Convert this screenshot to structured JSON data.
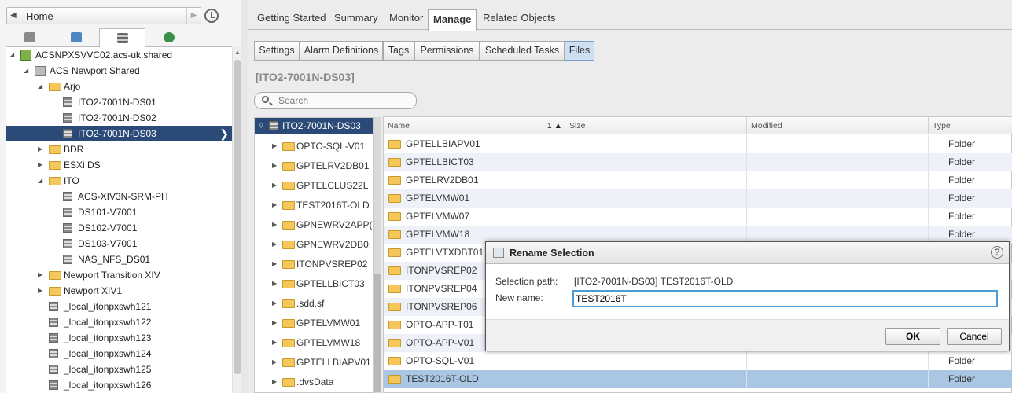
{
  "nav": {
    "home_label": "Home"
  },
  "inventory_tree": [
    {
      "label": "ACSNPXSVVC02.acs-uk.shared",
      "icon": "vcenter",
      "depth": 0,
      "expanded": true
    },
    {
      "label": "ACS Newport Shared",
      "icon": "datacenter",
      "depth": 1,
      "expanded": true
    },
    {
      "label": "Arjo",
      "icon": "folder",
      "depth": 2,
      "expanded": true
    },
    {
      "label": "ITO2-7001N-DS01",
      "icon": "datastore",
      "depth": 3
    },
    {
      "label": "ITO2-7001N-DS02",
      "icon": "datastore",
      "depth": 3
    },
    {
      "label": "ITO2-7001N-DS03",
      "icon": "datastore",
      "depth": 3,
      "selected": true
    },
    {
      "label": "BDR",
      "icon": "folder",
      "depth": 2,
      "expanded": false
    },
    {
      "label": "ESXi DS",
      "icon": "folder",
      "depth": 2,
      "expanded": false
    },
    {
      "label": "ITO",
      "icon": "folder",
      "depth": 2,
      "expanded": true
    },
    {
      "label": "ACS-XIV3N-SRM-PH",
      "icon": "datastore",
      "depth": 3
    },
    {
      "label": "DS101-V7001",
      "icon": "datastore",
      "depth": 3
    },
    {
      "label": "DS102-V7001",
      "icon": "datastore",
      "depth": 3
    },
    {
      "label": "DS103-V7001",
      "icon": "datastore",
      "depth": 3
    },
    {
      "label": "NAS_NFS_DS01",
      "icon": "datastore",
      "depth": 3
    },
    {
      "label": "Newport Transition XIV",
      "icon": "folder",
      "depth": 2,
      "expanded": false
    },
    {
      "label": "Newport XIV1",
      "icon": "folder",
      "depth": 2,
      "expanded": false
    },
    {
      "label": "_local_itonpxswh121",
      "icon": "datastore",
      "depth": 2
    },
    {
      "label": "_local_itonpxswh122",
      "icon": "datastore",
      "depth": 2
    },
    {
      "label": "_local_itonpxswh123",
      "icon": "datastore",
      "depth": 2
    },
    {
      "label": "_local_itonpxswh124",
      "icon": "datastore",
      "depth": 2
    },
    {
      "label": "_local_itonpxswh125",
      "icon": "datastore",
      "depth": 2
    },
    {
      "label": "_local_itonpxswh126",
      "icon": "datastore",
      "depth": 2
    }
  ],
  "top_tabs": [
    "Getting Started",
    "Summary",
    "Monitor",
    "Manage",
    "Related Objects"
  ],
  "active_top_tab": "Manage",
  "sub_tabs": [
    "Settings",
    "Alarm Definitions",
    "Tags",
    "Permissions",
    "Scheduled Tasks",
    "Files"
  ],
  "active_sub_tab": "Files",
  "datastore_title": "[ITO2-7001N-DS03]",
  "search": {
    "placeholder": "Search"
  },
  "file_tree": {
    "root": "ITO2-7001N-DS03",
    "children": [
      "OPTO-SQL-V01",
      "GPTELRV2DB01",
      "GPTELCLUS22L",
      "TEST2016T-OLD",
      "GPNEWRV2APP(",
      "GPNEWRV2DB0:",
      "ITONPVSREP02",
      "GPTELLBICT03",
      ".sdd.sf",
      "GPTELVMW01",
      "GPTELVMW18",
      "GPTELLBIAPV01",
      ".dvsData"
    ]
  },
  "grid": {
    "columns": [
      "Name",
      "Size",
      "Modified",
      "Type"
    ],
    "sort_indicator": "1 ▲",
    "rows": [
      {
        "name": "GPTELLBIAPV01",
        "type": "Folder"
      },
      {
        "name": "GPTELLBICT03",
        "type": "Folder"
      },
      {
        "name": "GPTELRV2DB01",
        "type": "Folder"
      },
      {
        "name": "GPTELVMW01",
        "type": "Folder"
      },
      {
        "name": "GPTELVMW07",
        "type": "Folder"
      },
      {
        "name": "GPTELVMW18",
        "type": "Folder"
      },
      {
        "name": "GPTELVTXDBT01",
        "type": ""
      },
      {
        "name": "ITONPVSREP02",
        "type": ""
      },
      {
        "name": "ITONPVSREP04",
        "type": ""
      },
      {
        "name": "ITONPVSREP06",
        "type": ""
      },
      {
        "name": "OPTO-APP-T01",
        "type": ""
      },
      {
        "name": "OPTO-APP-V01",
        "type": ""
      },
      {
        "name": "OPTO-SQL-V01",
        "type": "Folder"
      },
      {
        "name": "TEST2016T-OLD",
        "type": "Folder",
        "selected": true
      }
    ]
  },
  "dialog": {
    "title": "Rename Selection",
    "help": "?",
    "selection_path_label": "Selection path:",
    "selection_path_value": "[ITO2-7001N-DS03] TEST2016T-OLD",
    "new_name_label": "New name:",
    "new_name_value": "TEST2016T",
    "ok_label": "OK",
    "cancel_label": "Cancel"
  },
  "colors": {
    "selection": "#2b4a78",
    "grid_selection": "#a9c6e3",
    "active_sub_tab": "#cfdff2",
    "focus": "#4a9cd6"
  }
}
